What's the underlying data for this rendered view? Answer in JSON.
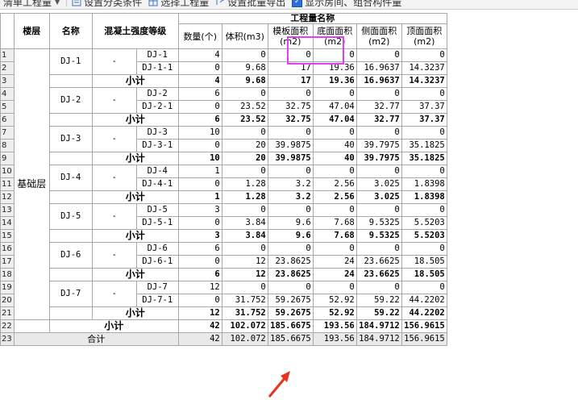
{
  "toolbar": {
    "items": [
      {
        "label": "清单工程量"
      },
      {
        "label": "设置分类条件"
      },
      {
        "label": "选择工程量"
      },
      {
        "label": "设置批量导出"
      },
      {
        "label": "显示房间、组合构件量"
      }
    ]
  },
  "header": {
    "floor": "楼层",
    "name": "名称",
    "grade": "混凝土强度等级",
    "group": "工程量名称",
    "cols": [
      "数量(个)",
      "体积(m3)",
      "模板面积(m2)",
      "底面面积(m2)",
      "侧面面积(m2)",
      "顶面面积(m2)"
    ]
  },
  "floor_label": "基础层",
  "subtotal_label": "小计",
  "grade_dash": "-",
  "rows": [
    {
      "n": "1",
      "sub": "DJ-1",
      "v": [
        "4",
        "0",
        "0",
        "0",
        "0",
        "0"
      ]
    },
    {
      "n": "2",
      "sub": "DJ-1-1",
      "v": [
        "0",
        "9.68",
        "17",
        "19.36",
        "16.9637",
        "14.3237"
      ]
    },
    {
      "n": "3",
      "v": [
        "4",
        "9.68",
        "17",
        "19.36",
        "16.9637",
        "14.3237"
      ]
    },
    {
      "n": "4",
      "sub": "DJ-2",
      "v": [
        "6",
        "0",
        "0",
        "0",
        "0",
        "0"
      ]
    },
    {
      "n": "5",
      "sub": "DJ-2-1",
      "v": [
        "0",
        "23.52",
        "32.75",
        "47.04",
        "32.77",
        "37.37"
      ]
    },
    {
      "n": "6",
      "v": [
        "6",
        "23.52",
        "32.75",
        "47.04",
        "32.77",
        "37.37"
      ]
    },
    {
      "n": "7",
      "sub": "DJ-3",
      "v": [
        "10",
        "0",
        "0",
        "0",
        "0",
        "0"
      ]
    },
    {
      "n": "8",
      "sub": "DJ-3-1",
      "v": [
        "0",
        "20",
        "39.9875",
        "40",
        "39.7975",
        "35.1825"
      ]
    },
    {
      "n": "9",
      "v": [
        "10",
        "20",
        "39.9875",
        "40",
        "39.7975",
        "35.1825"
      ]
    },
    {
      "n": "10",
      "sub": "DJ-4",
      "v": [
        "1",
        "0",
        "0",
        "0",
        "0",
        "0"
      ]
    },
    {
      "n": "11",
      "sub": "DJ-4-1",
      "v": [
        "0",
        "1.28",
        "3.2",
        "2.56",
        "3.025",
        "1.8398"
      ]
    },
    {
      "n": "12",
      "v": [
        "1",
        "1.28",
        "3.2",
        "2.56",
        "3.025",
        "1.8398"
      ]
    },
    {
      "n": "13",
      "sub": "DJ-5",
      "v": [
        "3",
        "0",
        "0",
        "0",
        "0",
        "0"
      ]
    },
    {
      "n": "14",
      "sub": "DJ-5-1",
      "v": [
        "0",
        "3.84",
        "9.6",
        "7.68",
        "9.5325",
        "5.5203"
      ]
    },
    {
      "n": "15",
      "v": [
        "3",
        "3.84",
        "9.6",
        "7.68",
        "9.5325",
        "5.5203"
      ]
    },
    {
      "n": "16",
      "sub": "DJ-6",
      "v": [
        "6",
        "0",
        "0",
        "0",
        "0",
        "0"
      ]
    },
    {
      "n": "17",
      "sub": "DJ-6-1",
      "v": [
        "0",
        "12",
        "23.8625",
        "24",
        "23.6625",
        "18.505"
      ]
    },
    {
      "n": "18",
      "v": [
        "6",
        "12",
        "23.8625",
        "24",
        "23.6625",
        "18.505"
      ]
    },
    {
      "n": "19",
      "sub": "DJ-7",
      "v": [
        "12",
        "0",
        "0",
        "0",
        "0",
        "0"
      ]
    },
    {
      "n": "20",
      "sub": "DJ-7-1",
      "v": [
        "0",
        "31.752",
        "59.2675",
        "52.92",
        "59.22",
        "44.2202"
      ]
    },
    {
      "n": "21",
      "v": [
        "12",
        "31.752",
        "59.2675",
        "52.92",
        "59.22",
        "44.2202"
      ]
    },
    {
      "n": "22",
      "v": [
        "42",
        "102.072",
        "185.6675",
        "193.56",
        "184.9712",
        "156.9615"
      ]
    },
    {
      "n": "23",
      "v": [
        "42",
        "102.072",
        "185.6675",
        "193.56",
        "184.9712",
        "156.9615"
      ]
    }
  ],
  "groups": [
    "DJ-1",
    "DJ-2",
    "DJ-3",
    "DJ-4",
    "DJ-5",
    "DJ-6",
    "DJ-7"
  ],
  "floor_subtotal_label": "小计",
  "grand_total_label": "合计",
  "colors": {
    "highlight": "#e63df0",
    "arrow": "#e8321e",
    "check": "#2d6fd6"
  }
}
